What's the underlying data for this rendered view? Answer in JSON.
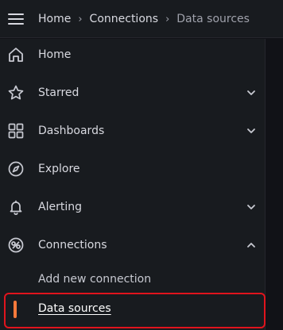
{
  "breadcrumb": {
    "items": [
      "Home",
      "Connections",
      "Data sources"
    ]
  },
  "nav": {
    "items": [
      {
        "label": "Home",
        "icon": "home-icon",
        "chevron": ""
      },
      {
        "label": "Starred",
        "icon": "star-icon",
        "chevron": "down"
      },
      {
        "label": "Dashboards",
        "icon": "dashboards-icon",
        "chevron": "down"
      },
      {
        "label": "Explore",
        "icon": "compass-icon",
        "chevron": ""
      },
      {
        "label": "Alerting",
        "icon": "bell-icon",
        "chevron": "down"
      },
      {
        "label": "Connections",
        "icon": "connections-icon",
        "chevron": "up"
      }
    ],
    "sub_items": [
      {
        "label": "Add new connection",
        "active": false
      },
      {
        "label": "Data sources",
        "active": true
      }
    ]
  },
  "colors": {
    "background": "#181b1f",
    "text": "#d8d9e0",
    "active_indicator": "#f97a3b",
    "highlight_outline": "#e0141d"
  }
}
